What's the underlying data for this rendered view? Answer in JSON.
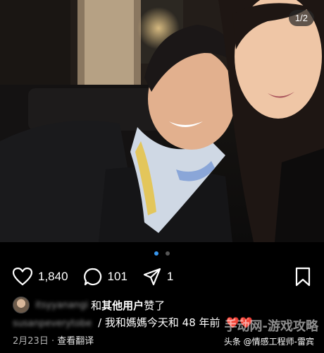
{
  "post": {
    "image_counter": "1/2"
  },
  "actions": {
    "like_count": "1,840",
    "comment_count": "101",
    "share_count": "1"
  },
  "likes": {
    "blurred_user": "itsyyanangi",
    "suffix_plain": "和",
    "suffix_bold": "其他用户",
    "suffix_end": "赞了"
  },
  "caption": {
    "blurred_user": "susanpeverytobe",
    "text": "/ 我和媽媽今天和 48 年前",
    "hearts": "❤️❤️"
  },
  "meta": {
    "date": "2月23日",
    "separator": "·",
    "translate": "查看翻译"
  },
  "overlay": {
    "watermark": "手动网-游戏攻略",
    "source": "头条 @情感工程师-雷宾"
  }
}
